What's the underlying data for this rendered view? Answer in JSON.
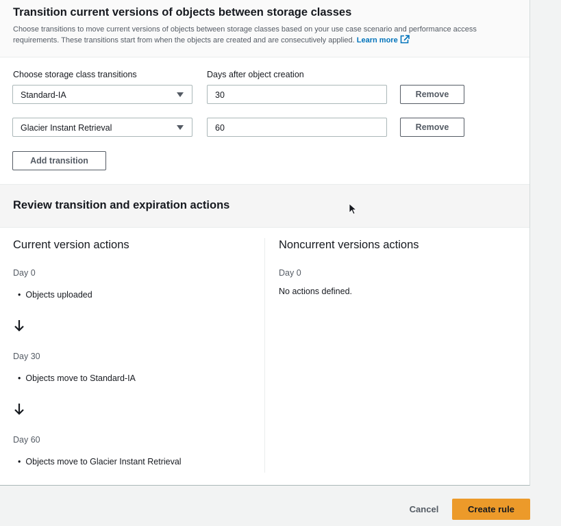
{
  "transitions_section": {
    "title": "Transition current versions of objects between storage classes",
    "description": "Choose transitions to move current versions of objects between storage classes based on your use case scenario and performance access requirements. These transitions start from when the objects are created and are consecutively applied.",
    "learn_more": "Learn more",
    "storage_class_label": "Choose storage class transitions",
    "days_label": "Days after object creation",
    "rows": [
      {
        "storage_class": "Standard-IA",
        "days": "30",
        "remove_label": "Remove"
      },
      {
        "storage_class": "Glacier Instant Retrieval",
        "days": "60",
        "remove_label": "Remove"
      }
    ],
    "add_transition_label": "Add transition"
  },
  "review": {
    "title": "Review transition and expiration actions",
    "current": {
      "title": "Current version actions",
      "steps": [
        {
          "day": "Day 0",
          "action": "Objects uploaded"
        },
        {
          "day": "Day 30",
          "action": "Objects move to Standard-IA"
        },
        {
          "day": "Day 60",
          "action": "Objects move to Glacier Instant Retrieval"
        }
      ]
    },
    "noncurrent": {
      "title": "Noncurrent versions actions",
      "day": "Day 0",
      "message": "No actions defined."
    }
  },
  "footer": {
    "cancel_label": "Cancel",
    "create_label": "Create rule"
  },
  "colors": {
    "primary_button": "#ec9a2a",
    "link": "#0073bb"
  }
}
